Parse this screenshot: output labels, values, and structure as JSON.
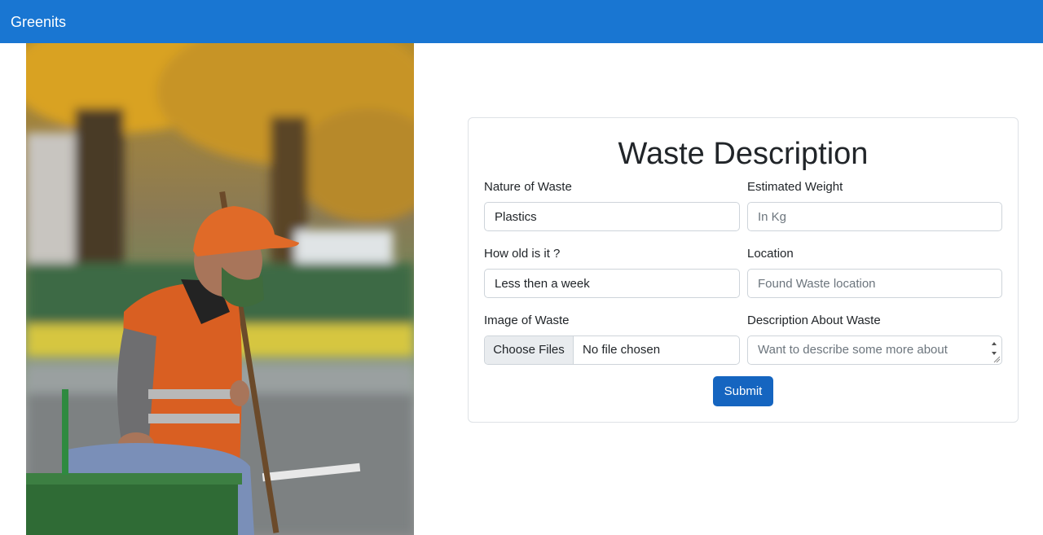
{
  "navbar": {
    "brand": "Greenits"
  },
  "image": {
    "subject": "sanitation-worker-photo"
  },
  "form": {
    "title": "Waste Description",
    "nature": {
      "label": "Nature of Waste",
      "value": "Plastics"
    },
    "weight": {
      "label": "Estimated Weight",
      "placeholder": "In Kg"
    },
    "age": {
      "label": "How old is it ?",
      "value": "Less then a week"
    },
    "location": {
      "label": "Location",
      "placeholder": "Found Waste location"
    },
    "image": {
      "label": "Image of Waste",
      "button": "Choose Files",
      "status": "No file chosen"
    },
    "description": {
      "label": "Description About Waste",
      "placeholder": "Want to describe some more about"
    },
    "submit": "Submit"
  },
  "colors": {
    "navbar": "#1976d2",
    "primary_button": "#1565c0"
  }
}
